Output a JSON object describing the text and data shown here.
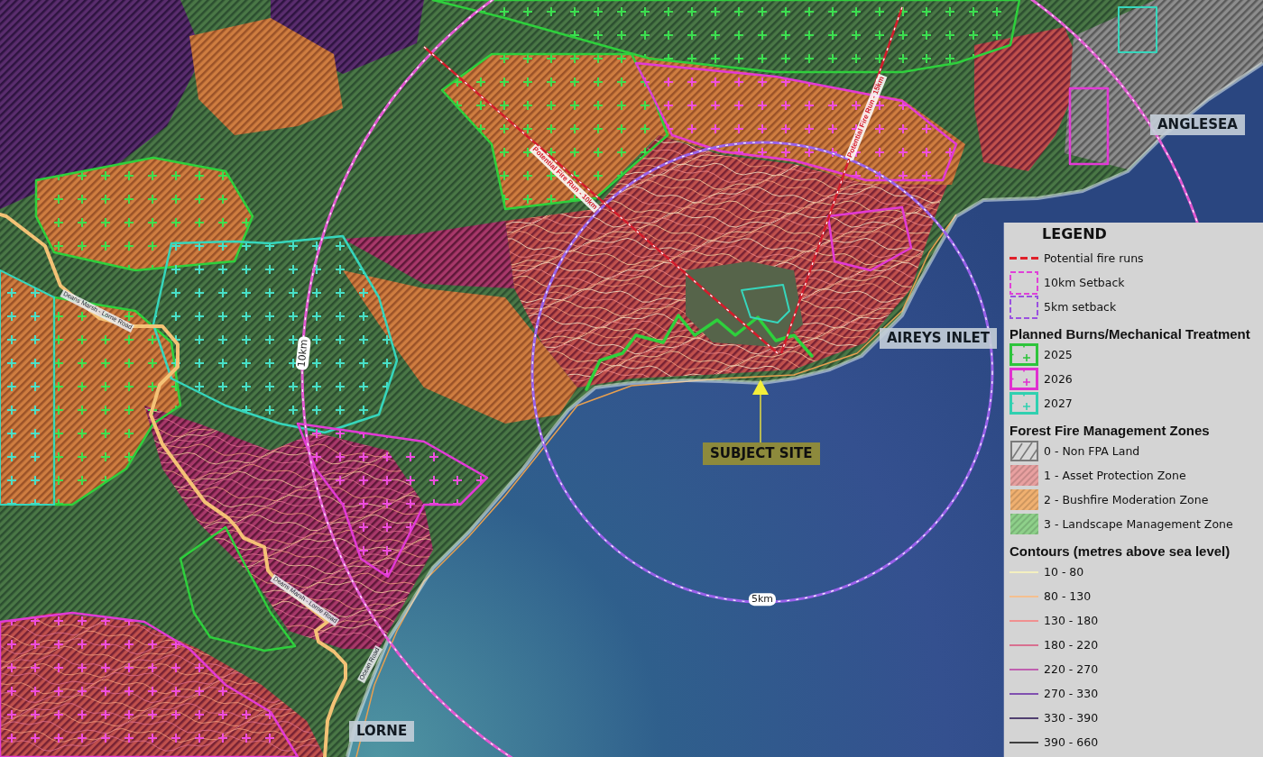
{
  "map": {
    "place_labels": [
      {
        "text": "ANGLESEA"
      },
      {
        "text": "AIREYS INLET"
      },
      {
        "text": "LORNE"
      }
    ],
    "subject_site": {
      "label": "SUBJECT SITE"
    },
    "setback_rings": [
      {
        "label": "10km"
      },
      {
        "label": "5km"
      }
    ],
    "fire_runs": [
      {
        "label": "Potential Fire Run - 10km"
      },
      {
        "label": "Potential Fire Run - 15km"
      }
    ],
    "road_labels": [
      {
        "text": "Deans Marsh - Lorne Road"
      },
      {
        "text": "Deans Marsh - Lorne Road"
      },
      {
        "text": "Ocean Road"
      }
    ]
  },
  "legend": {
    "title": "LEGEND",
    "sections": [
      {
        "items": [
          {
            "kind": "dashed-line",
            "color": "#e0202a",
            "label": "Potential fire runs"
          },
          {
            "kind": "dashed-box",
            "color": "#e040d8",
            "label": "10km Setback"
          },
          {
            "kind": "dashed-box",
            "color": "#9a50e0",
            "label": "5km setback"
          }
        ]
      },
      {
        "heading": "Planned Burns/Mechanical Treatment",
        "items": [
          {
            "kind": "cross-box",
            "color": "#2ec43c",
            "label": "2025"
          },
          {
            "kind": "cross-box",
            "color": "#e030d0",
            "label": "2026"
          },
          {
            "kind": "cross-box",
            "color": "#30d0b0",
            "label": "2027"
          }
        ]
      },
      {
        "heading": "Forest Fire Management Zones",
        "items": [
          {
            "kind": "outline-hatch",
            "color": "#7a7a7a",
            "label": "0 - Non FPA Land"
          },
          {
            "kind": "hatch",
            "color": "#e8a0a0",
            "label": "1 - Asset Protection Zone"
          },
          {
            "kind": "hatch",
            "color": "#f0b070",
            "label": "2 - Bushfire Moderation Zone"
          },
          {
            "kind": "hatch",
            "color": "#8ed08a",
            "label": "3 - Landscape Management Zone"
          }
        ]
      },
      {
        "heading": "Contours (metres above sea level)",
        "items": [
          {
            "kind": "line",
            "color": "#f4f0c0",
            "label": "10 - 80"
          },
          {
            "kind": "line",
            "color": "#f4c090",
            "label": "80 - 130"
          },
          {
            "kind": "line",
            "color": "#f09090",
            "label": "130 - 180"
          },
          {
            "kind": "line",
            "color": "#d87090",
            "label": "180 - 220"
          },
          {
            "kind": "line",
            "color": "#c060b0",
            "label": "220 - 270"
          },
          {
            "kind": "line",
            "color": "#8050b0",
            "label": "270 - 330"
          },
          {
            "kind": "line",
            "color": "#504070",
            "label": "330 - 390"
          },
          {
            "kind": "line",
            "color": "#404040",
            "label": "390 - 660"
          }
        ]
      }
    ]
  }
}
